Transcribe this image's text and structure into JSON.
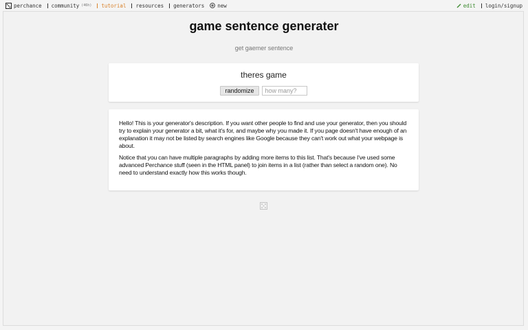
{
  "nav": {
    "left": [
      {
        "label": "perchance",
        "icon": "dice-icon"
      },
      {
        "label": "community",
        "sub": "(46h)",
        "icon": "community-icon"
      },
      {
        "label": "tutorial",
        "icon": "tutorial-icon"
      },
      {
        "label": "resources",
        "icon": "resources-icon"
      },
      {
        "label": "generators",
        "icon": "generators-icon"
      },
      {
        "label": "new",
        "icon": "plus-circle-icon"
      }
    ],
    "right": [
      {
        "label": "edit",
        "icon": "pencil-icon"
      },
      {
        "label": "login/signup",
        "icon": "user-icon"
      }
    ],
    "colors": {
      "tutorial": "#d9822b",
      "edit": "#3b8a2e"
    }
  },
  "page": {
    "title": "game sentence generater",
    "subtitle": "get gaemer sentence"
  },
  "output": {
    "text": "theres game",
    "randomize_label": "randomize",
    "count_placeholder": "how many?"
  },
  "description": {
    "paragraphs": [
      "Hello! This is your generator's description. If you want other people to find and use your generator, then you should try to explain your generator a bit, what it's for, and maybe why you made it. If you page doesn't have enough of an explanation it may not be listed by search engines like Google because they can't work out what your webpage is about.",
      "Notice that you can have multiple paragraphs by adding more items to this list. That's because I've used some advanced Perchance stuff (seen in the HTML panel) to join items in a list (rather than select a random one). No need to understand exactly how this works though."
    ]
  },
  "footer": {
    "icon": "dice-icon"
  }
}
